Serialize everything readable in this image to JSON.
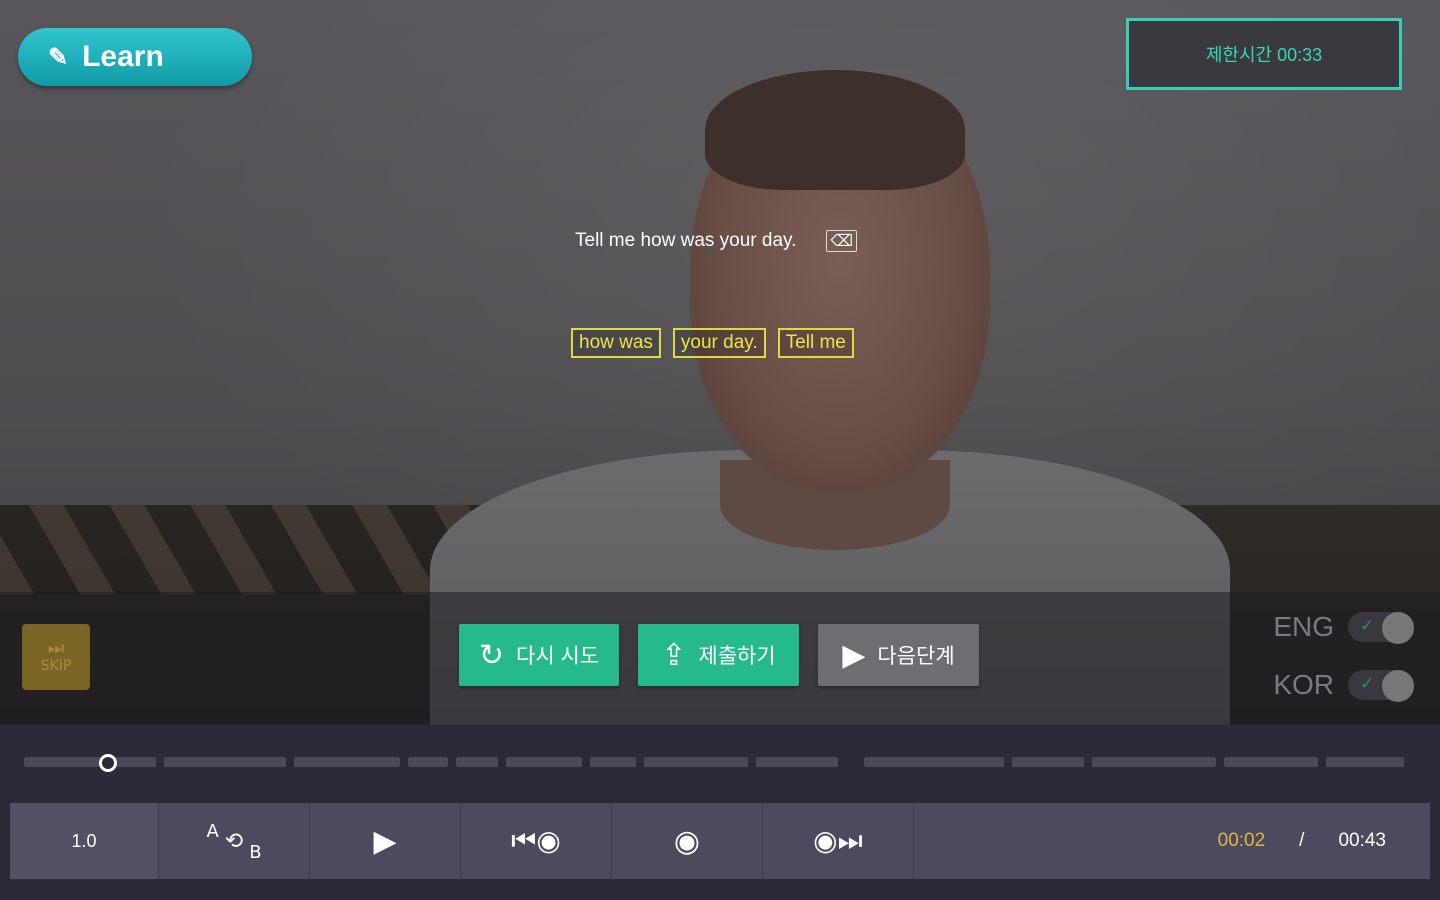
{
  "header": {
    "learn_label": "Learn",
    "timer_label": "제한시간 00:33"
  },
  "prompt": {
    "sentence": "Tell me how was your day.",
    "backspace_icon": "backspace-icon",
    "chips": [
      "how was",
      "your day.",
      "Tell me"
    ]
  },
  "actions": {
    "skip_label": "SKIP",
    "retry_label": "다시 시도",
    "submit_label": "제출하기",
    "next_label": "다음단계",
    "accent_color": "#25b98c"
  },
  "toggles": [
    {
      "label": "ENG",
      "checked": true
    },
    {
      "label": "KOR",
      "checked": true
    }
  ],
  "player": {
    "speed": "1.0",
    "ab_a": "A",
    "ab_b": "B",
    "current_time": "00:02",
    "separator": "/",
    "total_time": "00:43",
    "progress_fraction": 0.05
  }
}
